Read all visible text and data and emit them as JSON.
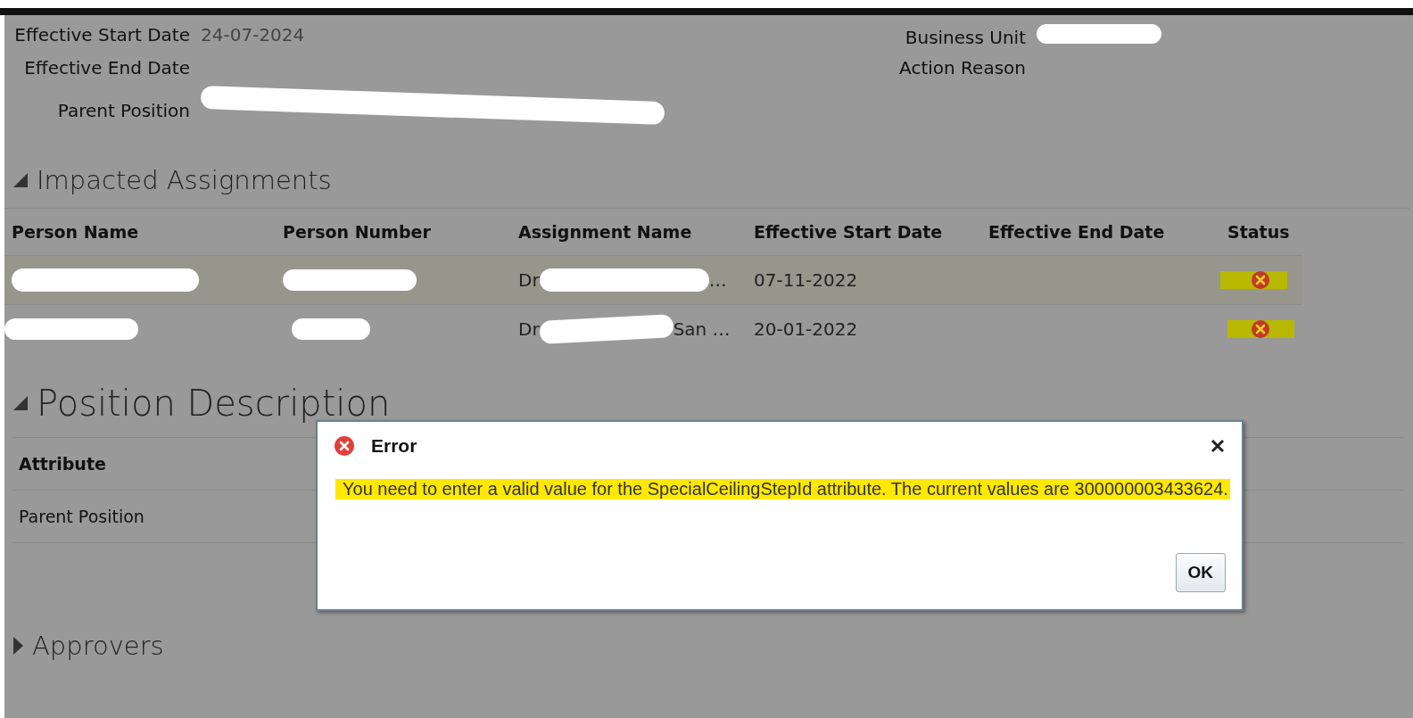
{
  "header": {
    "fields_left": [
      {
        "label": "Effective Start Date",
        "value": "24-07-2024",
        "redacted": false
      },
      {
        "label": "Effective End Date",
        "redacted": false
      },
      {
        "label": "Parent Position",
        "redacted": true
      }
    ],
    "fields_right": [
      {
        "label": "Business Unit",
        "redacted": true
      },
      {
        "label": "Action Reason",
        "redacted": false
      }
    ]
  },
  "impacted_assignments": {
    "title": "Impacted Assignments",
    "expanded": true,
    "columns": [
      "Person Name",
      "Person Number",
      "Assignment Name",
      "Effective Start Date",
      "Effective End Date",
      "Status"
    ],
    "rows": [
      {
        "selected": true,
        "assignment_prefix": "Dr",
        "assignment_suffix": "…",
        "effective_start_date": "07-11-2022",
        "kind": "error"
      },
      {
        "selected": false,
        "assignment_prefix": "Dr",
        "assignment_suffix": "San …",
        "effective_start_date": "20-01-2022",
        "kind": "error"
      }
    ]
  },
  "position_description": {
    "title": "Position Description",
    "expanded": true,
    "rows": [
      {
        "label": "Attribute",
        "kind": "header"
      },
      {
        "label": "Parent Position",
        "kind": "row"
      }
    ]
  },
  "approvers": {
    "title": "Approvers",
    "expanded": false
  },
  "dialog": {
    "title": "Error",
    "message": "You need to enter a valid value for the SpecialCeilingStepId attribute. The current values are 300000003433624.",
    "buttons": [
      "OK"
    ]
  }
}
